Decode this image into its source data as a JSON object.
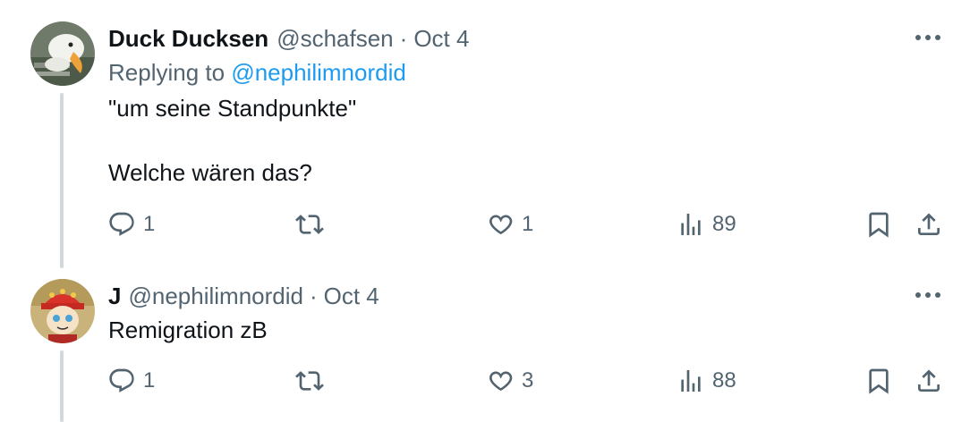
{
  "tweets": [
    {
      "display_name": "Duck Ducksen",
      "handle": "@schafsen",
      "dot": "·",
      "date": "Oct 4",
      "replying_prefix": "Replying to ",
      "replying_to": "@nephilimnordid",
      "text_lines": [
        "\"um seine Standpunkte\"",
        "Welche wären das?"
      ],
      "replies": "1",
      "reposts": "",
      "likes": "1",
      "views": "89"
    },
    {
      "display_name": "J",
      "handle": "@nephilimnordid",
      "dot": "·",
      "date": "Oct 4",
      "text_lines": [
        "Remigration zB"
      ],
      "replies": "1",
      "reposts": "",
      "likes": "3",
      "views": "88"
    }
  ],
  "colors": {
    "text": "#0f1419",
    "secondary": "#536471",
    "link": "#1d9bf0",
    "thread_line": "#cfd9de"
  },
  "icons": [
    "more-icon",
    "reply-icon",
    "repost-icon",
    "like-icon",
    "views-icon",
    "bookmark-icon",
    "share-icon"
  ]
}
